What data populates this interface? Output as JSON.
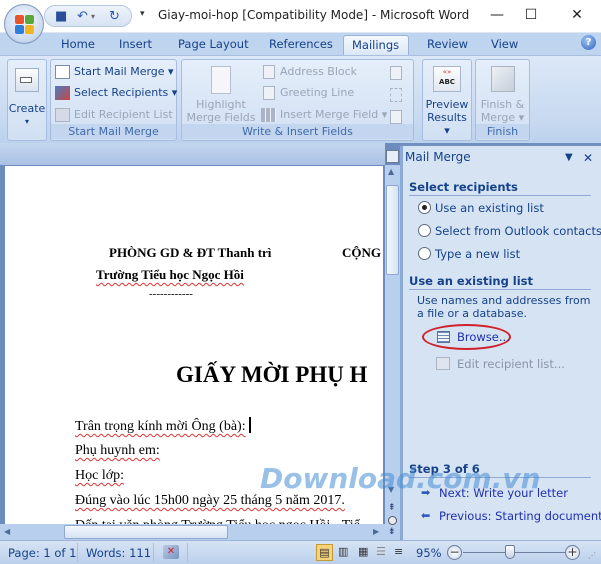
{
  "window": {
    "title": "Giay-moi-hop [Compatibility Mode] - Microsoft Word",
    "controls": {
      "minimize": "—",
      "maximize": "☐",
      "close": "✕"
    }
  },
  "quick_access": {
    "save_icon": "save-icon",
    "undo_icon": "undo-icon",
    "redo_icon": "redo-icon",
    "customize_icon": "customize-qat-icon"
  },
  "tabs": [
    {
      "label": "Home"
    },
    {
      "label": "Insert"
    },
    {
      "label": "Page Layout"
    },
    {
      "label": "References"
    },
    {
      "label": "Mailings",
      "active": true
    },
    {
      "label": "Review"
    },
    {
      "label": "View"
    }
  ],
  "help_label": "?",
  "ribbon": {
    "create": {
      "label": "Create",
      "arrow": "▾"
    },
    "start_mail_merge": {
      "group_label": "Start Mail Merge",
      "items": [
        {
          "label": "Start Mail Merge ▾",
          "enabled": true
        },
        {
          "label": "Select Recipients ▾",
          "enabled": true
        },
        {
          "label": "Edit Recipient List",
          "enabled": false
        }
      ]
    },
    "write_insert": {
      "group_label": "Write & Insert Fields",
      "highlight": {
        "line1": "Highlight",
        "line2": "Merge Fields"
      },
      "items": [
        {
          "label": "Address Block",
          "enabled": false
        },
        {
          "label": "Greeting Line",
          "enabled": false
        },
        {
          "label": "Insert Merge Field ▾",
          "enabled": false
        }
      ]
    },
    "preview": {
      "line1": "Preview",
      "line2": "Results ▾",
      "icon_text": "«»",
      "icon_sub": "ABC"
    },
    "finish": {
      "group_label": "Finish",
      "line1": "Finish &",
      "line2": "Merge ▾"
    }
  },
  "document": {
    "lines": [
      "PHÒNG GD & ĐT Thanh trì",
      "CỘNG",
      "Trường Tiểu học Ngọc Hồi",
      "------------",
      "GIẤY MỜI PHỤ H",
      "Trân trọng kính mời Ông (bà):",
      "Phụ huynh em:",
      "Học lớp:",
      "Đúng vào lúc 15h00 ngày 25 tháng 5 năm 2017.",
      "Đến tại văn phòng Trường Tiểu học ngọc Hồi - Tiể"
    ]
  },
  "task_pane": {
    "title": "Mail Merge",
    "menu_icon": "▼",
    "close_icon": "✕",
    "select_recipients": {
      "heading": "Select recipients",
      "options": [
        {
          "label": "Use an existing list",
          "selected": true
        },
        {
          "label": "Select from Outlook contacts",
          "selected": false
        },
        {
          "label": "Type a new list",
          "selected": false
        }
      ]
    },
    "existing_list": {
      "heading": "Use an existing list",
      "description": "Use names and addresses from a file or a database.",
      "browse": "Browse...",
      "edit": "Edit recipient list..."
    },
    "step": {
      "heading": "Step 3 of 6",
      "next": "Next: Write your letter",
      "previous": "Previous: Starting document"
    }
  },
  "watermark": "Download.com.vn",
  "status_bar": {
    "page": "Page: 1 of 1",
    "words": "Words: 111",
    "zoom": "95%",
    "zoom_minus": "−",
    "zoom_plus": "+"
  }
}
